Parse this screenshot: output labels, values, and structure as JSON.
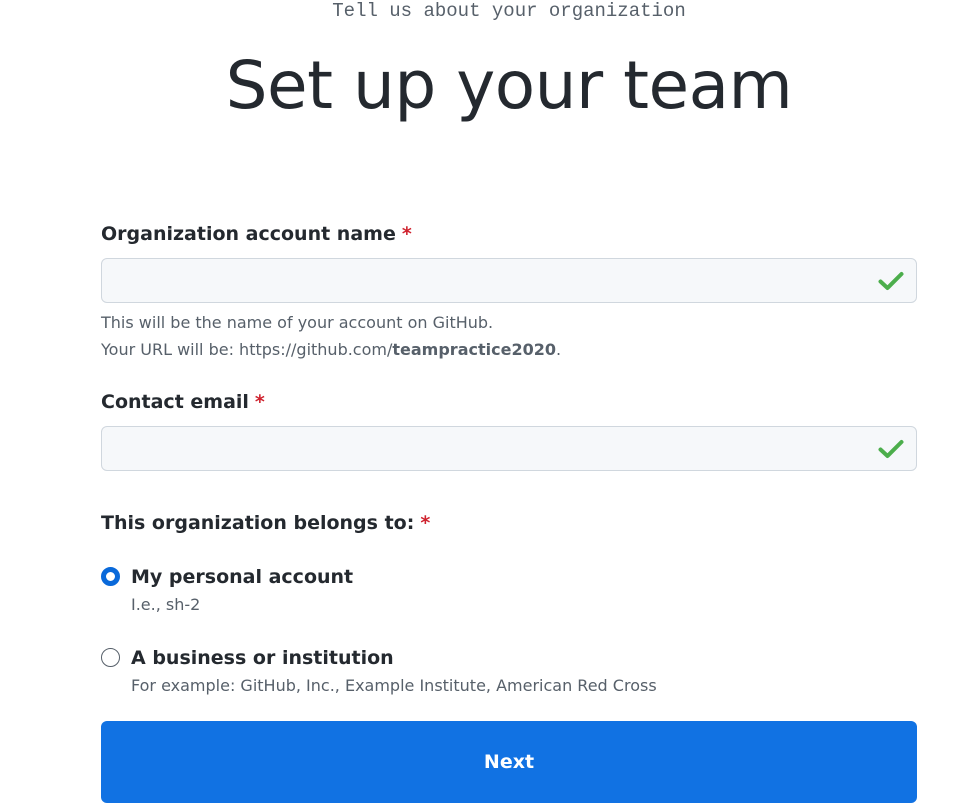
{
  "header": {
    "eyebrow": "Tell us about your organization",
    "title": "Set up your team"
  },
  "org_name": {
    "label": "Organization account name",
    "required_marker": "*",
    "value": "",
    "valid_icon": "checkmark-icon",
    "help_line1": "This will be the name of your account on GitHub.",
    "help_url_prefix": "Your URL will be: https://github.com/",
    "help_url_slug": "teampractice2020",
    "help_url_suffix": "."
  },
  "contact_email": {
    "label": "Contact email",
    "required_marker": "*",
    "value": "",
    "valid_icon": "checkmark-icon"
  },
  "belongs_to": {
    "label": "This organization belongs to:",
    "required_marker": "*",
    "options": [
      {
        "label": "My personal account",
        "note": "I.e., sh-2",
        "selected": true
      },
      {
        "label": "A business or institution",
        "note": "For example: GitHub, Inc., Example Institute, American Red Cross",
        "selected": false
      }
    ]
  },
  "next_button": {
    "label": "Next"
  },
  "colors": {
    "accent": "#1172e3",
    "radio_selected": "#0969da",
    "valid_check": "#4cae4c",
    "required": "#cf222e"
  }
}
